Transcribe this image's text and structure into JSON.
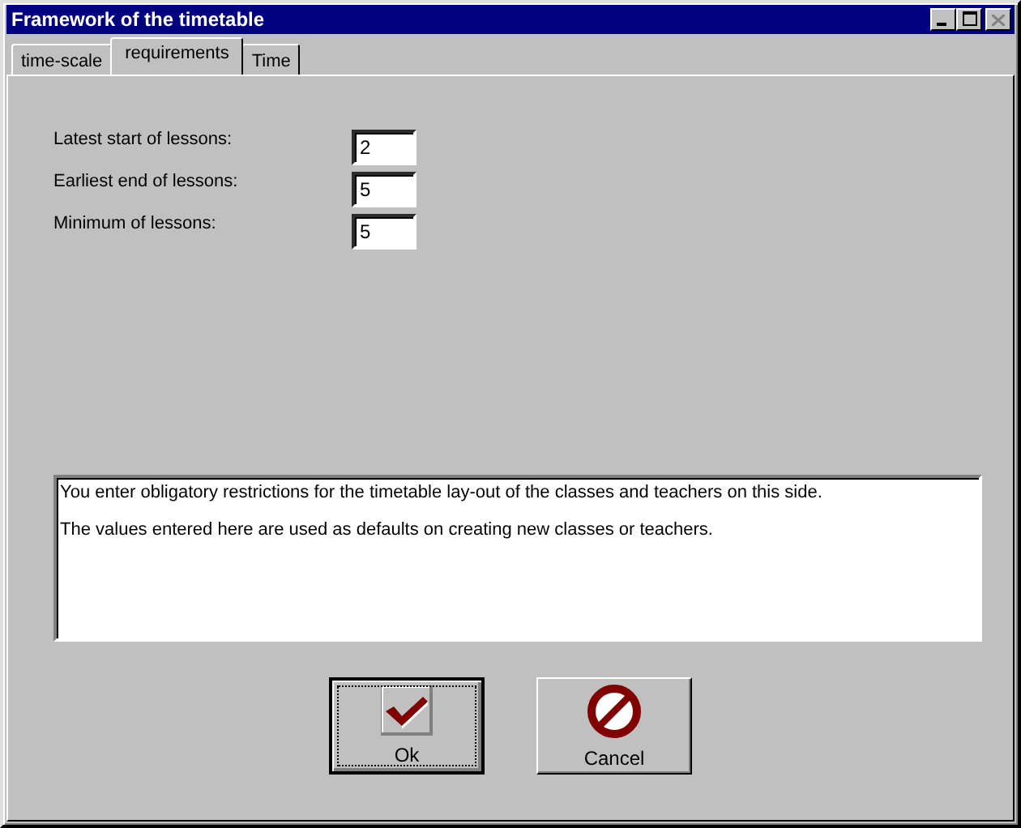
{
  "window": {
    "title": "Framework of the timetable"
  },
  "tabs": [
    {
      "label": "time-scale",
      "selected": false
    },
    {
      "label": "requirements",
      "selected": true
    },
    {
      "label": "Time",
      "selected": false
    }
  ],
  "fields": [
    {
      "label": "Latest start of lessons:",
      "value": "2"
    },
    {
      "label": "Earliest end of lessons:",
      "value": "5"
    },
    {
      "label": "Minimum of lessons:",
      "value": "5"
    }
  ],
  "description": [
    "You enter obligatory restrictions for the timetable lay-out of the classes and teachers on this side.",
    "The values entered here are used as defaults on creating new classes or teachers."
  ],
  "buttons": [
    {
      "label": "Ok",
      "kind": "ok",
      "focused": true
    },
    {
      "label": "Cancel",
      "kind": "cancel",
      "focused": false
    }
  ]
}
